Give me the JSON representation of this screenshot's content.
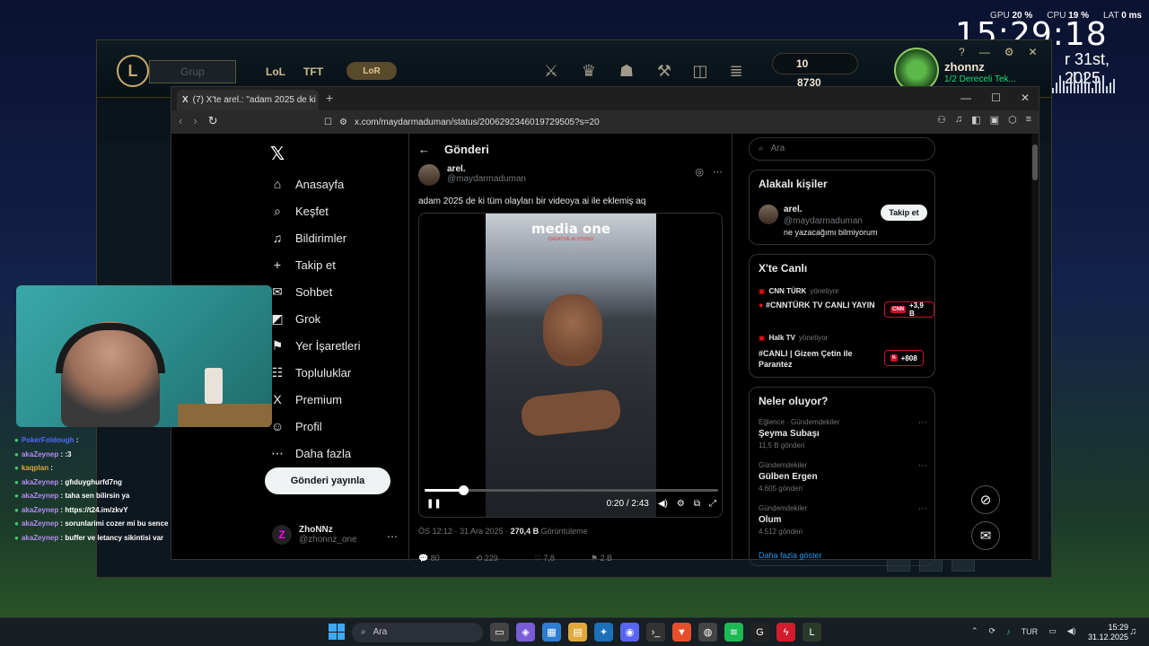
{
  "overlay": {
    "gpu_label": "GPU",
    "gpu_value": "20 %",
    "cpu_label": "CPU",
    "cpu_value": "19 %",
    "lat_label": "LAT",
    "lat_value": "0 ms",
    "clock": "15:29:18",
    "date": "r 31st, 2025"
  },
  "lol": {
    "logo": "L",
    "play_label": "Grup",
    "tabs": [
      "LoL",
      "TFT"
    ],
    "lor_label": "LoR",
    "currency_value": "10",
    "rp_value": "8730",
    "username": "zhonnz",
    "status": "1/2 Dereceli Tek...",
    "win_help": "?",
    "win_min": "—",
    "win_settings": "⚙",
    "win_close": "✕"
  },
  "browser": {
    "tab_title": "(7) X'te arel.: \"adam 2025 de ki",
    "tab_close": "×",
    "new_tab": "+",
    "url": "x.com/maydarmaduman/status/2006292346019729505?s=20",
    "win_min": "—",
    "win_max": "☐",
    "win_close": "✕"
  },
  "x": {
    "nav": [
      {
        "label": "Anasayfa",
        "icon": "⌂"
      },
      {
        "label": "Keşfet",
        "icon": "⌕"
      },
      {
        "label": "Bildirimler",
        "icon": "♫"
      },
      {
        "label": "Takip et",
        "icon": "+"
      },
      {
        "label": "Sohbet",
        "icon": "✉"
      },
      {
        "label": "Grok",
        "icon": "◩"
      },
      {
        "label": "Yer İşaretleri",
        "icon": "⚑"
      },
      {
        "label": "Topluluklar",
        "icon": "☷"
      },
      {
        "label": "Premium",
        "icon": "X"
      },
      {
        "label": "Profil",
        "icon": "☺"
      },
      {
        "label": "Daha fazla",
        "icon": "⋯"
      }
    ],
    "post_button": "Gönderi yayınla",
    "profile_name": "ZhoNNz",
    "profile_handle": "@zhonnz_one",
    "page_title": "Gönderi",
    "author_name": "arel.",
    "author_handle": "@maydarmaduman",
    "tweet_text": "adam 2025 de ki tüm olayları bir videoya ai ile eklemiş aq",
    "video_sign": "media one",
    "video_sign_sub": "CREATIVE AI STUDIO",
    "video_time": "0:20 / 2:43",
    "video_progress": 0.13,
    "tweet_time": "ÖS 12:12 · 31 Ara 2025 · ",
    "tweet_views": "270,4 B",
    "tweet_views_label": " Görüntüleme",
    "stats": [
      "80",
      "229",
      "7,8",
      "2 B"
    ],
    "search_placeholder": "Ara",
    "related_title": "Alakalı kişiler",
    "related_name": "arel.",
    "related_handle": "@maydarmaduman",
    "related_bio": "ne yazacağımı bilmiyorum",
    "follow_button": "Takip et",
    "live_title": "X'te Canlı",
    "live": [
      {
        "source": "CNN TÜRK",
        "role": "yönetiyor",
        "title": "#CNNTÜRK TV CANLI YAYIN",
        "count": "+3,9 B",
        "logo": "CNN"
      },
      {
        "source": "Halk TV",
        "role": "yönetiyor",
        "title": "#CANLI | Gizem Çetin ile Parantez",
        "count": "+808",
        "logo": "h"
      }
    ],
    "trends_title": "Neler oluyor?",
    "trends": [
      {
        "category": "Eğlence · Gündemdekiler",
        "name": "Şeyma Subaşı",
        "count": "11,5 B gönderi"
      },
      {
        "category": "Gündemdekiler",
        "name": "Gülben Ergen",
        "count": "4.605 gönderi"
      },
      {
        "category": "Gündemdekiler",
        "name": "Olum",
        "count": "4.512 gönderi"
      }
    ],
    "show_more": "Daha fazla göster"
  },
  "chat": [
    {
      "user": "akaZeynep",
      "msg": "gfıduyghurfd7ng",
      "style": "purple"
    },
    {
      "user": "akaZeynep",
      "msg": "taha sen bilirsin ya",
      "style": "purple"
    },
    {
      "user": "akaZeynep",
      "msg": "https://t24.im/zkvY",
      "style": "purple"
    },
    {
      "user": "akaZeynep",
      "msg": "sorunlarimi cozer mi bu sence",
      "style": "purple"
    },
    {
      "user": "akaZeynep",
      "msg": "buffer ve letancy sikintisi var",
      "style": "purple"
    }
  ],
  "chat_top": [
    {
      "user": "PokerFoldough",
      "msg": "",
      "style": "alt"
    },
    {
      "user": "akaZeynep",
      "msg": ":3",
      "style": "purple"
    },
    {
      "user": "kaqplan",
      "msg": "",
      "style": "gold"
    }
  ],
  "taskbar": {
    "search": "Ara",
    "lang": "TUR",
    "time": "15:29",
    "date": "31.12.2025"
  }
}
